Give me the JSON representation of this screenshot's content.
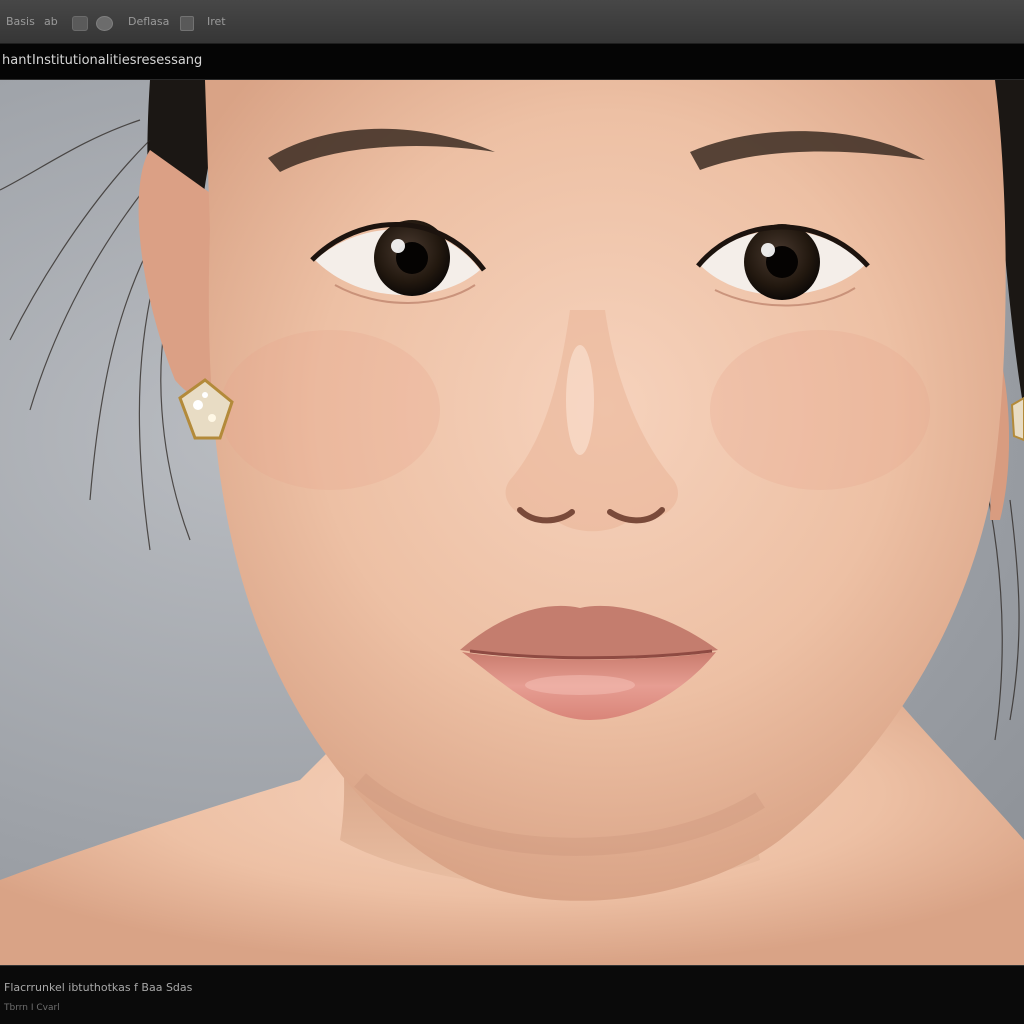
{
  "toolbar": {
    "item1": "Basis",
    "item2": "ab",
    "item3": "Deflasa",
    "item4": "Iret"
  },
  "titlebar": {
    "left": "hant",
    "title": "Institutionalitiesresessang"
  },
  "statusbar": {
    "line1": "Flacrrunkel ibtuthotkas f Baa Sdas",
    "line2": "Tbrrn I Cvarl"
  },
  "colors": {
    "toolbar_bg": "#3e3e3e",
    "titlebar_bg": "#050505",
    "canvas_bg": "#a2a6ac",
    "skin": "#f0c6ad",
    "lips": "#e3938a"
  }
}
